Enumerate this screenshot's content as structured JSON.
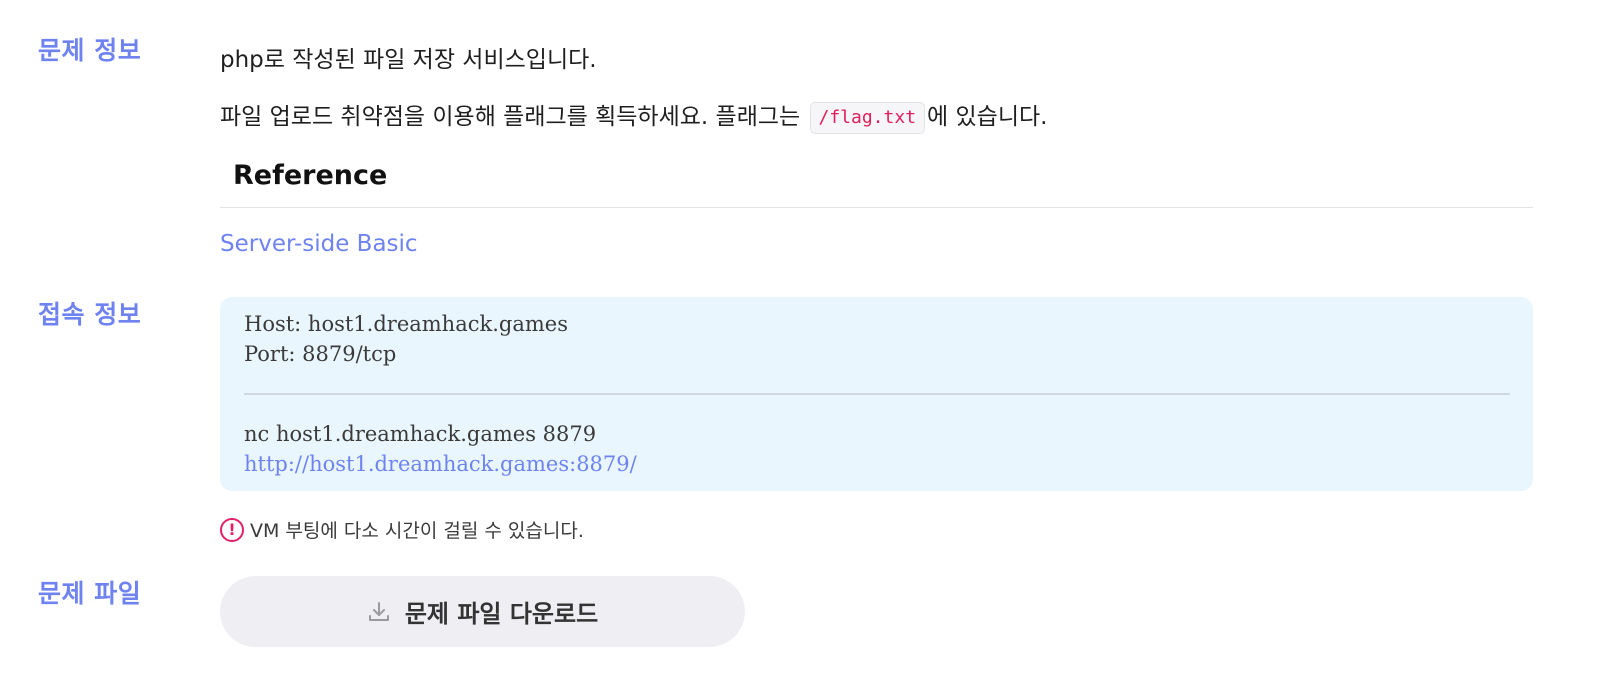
{
  "sections": {
    "problem_info_label": "문제 정보",
    "connection_info_label": "접속 정보",
    "problem_file_label": "문제 파일"
  },
  "description": {
    "line1": "php로 작성된 파일 저장 서비스입니다.",
    "line2_before": "파일 업로드 취약점을 이용해 플래그를 획득하세요. 플래그는",
    "line2_code": "/flag.txt",
    "line2_after": "에 있습니다."
  },
  "reference": {
    "heading": "Reference",
    "link_text": "Server-side Basic"
  },
  "connection": {
    "host": "Host: host1.dreamhack.games",
    "port": "Port: 8879/tcp",
    "nc_command": "nc host1.dreamhack.games 8879",
    "url": "http://host1.dreamhack.games:8879/"
  },
  "notice": {
    "text": "VM 부팅에 다소 시간이 걸릴 수 있습니다.",
    "icon": "exclamation-circle-icon"
  },
  "download": {
    "label": "문제 파일 다운로드",
    "icon": "download-icon"
  },
  "colors": {
    "accent": "#6f83f0",
    "code_text": "#e01e5a",
    "conn_bg": "#e9f6fd",
    "button_bg": "#efeff3"
  }
}
